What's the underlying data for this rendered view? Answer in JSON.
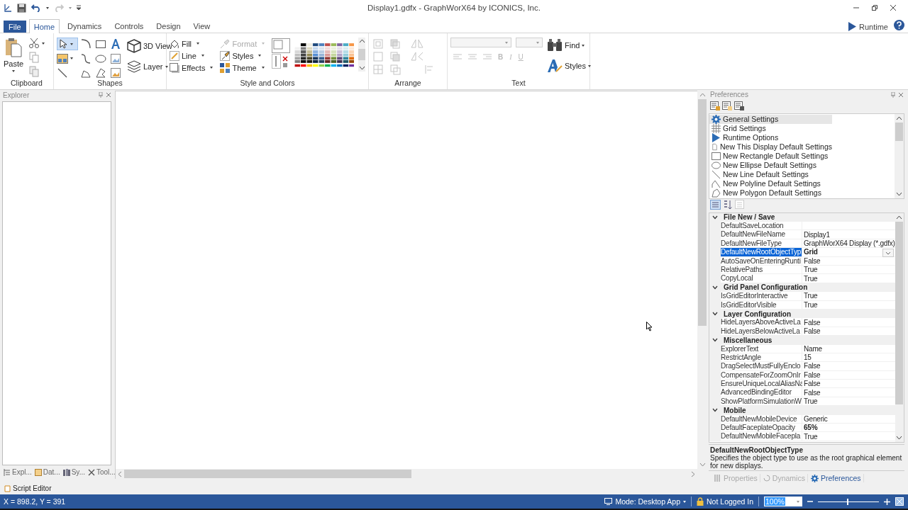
{
  "window": {
    "title": "Display1.gdfx - GraphWorX64 by ICONICS, Inc."
  },
  "ribbon_tabs": [
    {
      "label": "File",
      "kind": "file",
      "selected": false
    },
    {
      "label": "Home",
      "kind": "tab",
      "selected": true
    },
    {
      "label": "Dynamics",
      "kind": "tab",
      "selected": false
    },
    {
      "label": "Controls",
      "kind": "tab",
      "selected": false
    },
    {
      "label": "Design",
      "kind": "tab",
      "selected": false
    },
    {
      "label": "View",
      "kind": "tab",
      "selected": false
    }
  ],
  "runtime": {
    "label": "Runtime"
  },
  "ribbon": {
    "clipboard": {
      "label": "Clipboard",
      "paste": "Paste"
    },
    "shapes": {
      "label": "Shapes",
      "view3d": "3D View",
      "layer": "Layer"
    },
    "style": {
      "label": "Style and Colors",
      "items": [
        {
          "label": "Fill",
          "disabled": false
        },
        {
          "label": "Line",
          "disabled": false
        },
        {
          "label": "Effects",
          "disabled": false
        },
        {
          "label": "Format",
          "disabled": true
        },
        {
          "label": "Styles",
          "disabled": false
        },
        {
          "label": "Theme",
          "disabled": false
        }
      ]
    },
    "arrange": {
      "label": "Arrange"
    },
    "text": {
      "label": "Text",
      "format_buttons": [
        "B",
        "I",
        "U"
      ],
      "find": "Find",
      "styles": "Styles"
    }
  },
  "explorer": {
    "title": "Explorer",
    "tabs": [
      "Expl...",
      "Dat...",
      "Sy...",
      "Tool..."
    ]
  },
  "preferences": {
    "title": "Preferences",
    "items": [
      {
        "label": "General Settings",
        "selected": true
      },
      {
        "label": "Grid Settings",
        "selected": false
      },
      {
        "label": "Runtime Options",
        "selected": false
      },
      {
        "label": "New This Display Default Settings",
        "selected": false
      },
      {
        "label": "New Rectangle Default Settings",
        "selected": false
      },
      {
        "label": "New Ellipse Default Settings",
        "selected": false
      },
      {
        "label": "New Line Default Settings",
        "selected": false
      },
      {
        "label": "New Polyline Default Settings",
        "selected": false
      },
      {
        "label": "New Polygon Default Settings",
        "selected": false
      }
    ],
    "categories": [
      {
        "name": "File New / Save",
        "expanded": true,
        "rows": [
          {
            "name": "DefaultSaveLocation",
            "selected": false
          },
          {
            "name": "DefaultNewFileName",
            "value": "Display1",
            "selected": false,
            "modified": false
          },
          {
            "name": "DefaultNewFileType",
            "value": "GraphWorX64 Display (*.gdfx)",
            "selected": false,
            "modified": false
          },
          {
            "name": "DefaultNewRootObjectTyp",
            "value": "Grid",
            "selected": true,
            "modified": true
          },
          {
            "name": "AutoSaveOnEnteringRunti",
            "value": "False",
            "selected": false,
            "modified": false
          },
          {
            "name": "RelativePaths",
            "value": "True",
            "selected": false,
            "modified": false
          },
          {
            "name": "CopyLocal",
            "value": "True",
            "selected": false,
            "modified": false
          }
        ]
      },
      {
        "name": "Grid Panel Configuration",
        "expanded": true,
        "rows": [
          {
            "name": "IsGridEditorInteractive",
            "value": "True",
            "selected": false,
            "modified": false
          },
          {
            "name": "IsGridEditorVisible",
            "value": "True",
            "selected": false,
            "modified": false
          }
        ]
      },
      {
        "name": "Layer Configuration",
        "expanded": true,
        "rows": [
          {
            "name": "HideLayersAboveActiveLa",
            "value": "False",
            "selected": false,
            "modified": false
          },
          {
            "name": "HideLayersBelowActiveLa",
            "value": "False",
            "selected": false,
            "modified": false
          }
        ]
      },
      {
        "name": "Miscellaneous",
        "expanded": true,
        "rows": [
          {
            "name": "ExplorerText",
            "value": "Name",
            "selected": false,
            "modified": false
          },
          {
            "name": "RestrictAngle",
            "value": "15",
            "selected": false,
            "modified": false
          },
          {
            "name": "DragSelectMustFullyEnclo",
            "value": "False",
            "selected": false,
            "modified": false
          },
          {
            "name": "CompensateForZoomOnIr",
            "value": "False",
            "selected": false,
            "modified": false
          },
          {
            "name": "EnsureUniqueLocalAliasNa",
            "value": "False",
            "selected": false,
            "modified": false
          },
          {
            "name": "AdvancedBindingEditor",
            "value": "False",
            "selected": false,
            "modified": false
          },
          {
            "name": "ShowPlatformSimulationW",
            "value": "True",
            "selected": false,
            "modified": false
          }
        ]
      },
      {
        "name": "Mobile",
        "expanded": true,
        "rows": [
          {
            "name": "DefaultNewMobileDevice",
            "value": "Generic",
            "selected": false,
            "modified": false
          },
          {
            "name": "DefaultFaceplateOpacity",
            "value": "65%",
            "selected": false,
            "modified": true
          },
          {
            "name": "DefaultNewMobileFacepla",
            "value": "True",
            "selected": false,
            "modified": false
          }
        ]
      }
    ],
    "description": {
      "title": "DefaultNewRootObjectType",
      "text": "Specifies the object type to use as the root graphical element for new displays."
    }
  },
  "panel_tabs": [
    {
      "label": "Properties",
      "selected": false
    },
    {
      "label": "Dynamics",
      "selected": false
    },
    {
      "label": "Preferences",
      "selected": true
    }
  ],
  "script_editor": {
    "label": "Script Editor"
  },
  "status_bar": {
    "coordinates": "X = 898.2, Y = 391",
    "mode": "Mode: Desktop App",
    "login": "Not Logged In",
    "zoom": "100%",
    "zoom_slider": {
      "level": 0.49
    }
  }
}
